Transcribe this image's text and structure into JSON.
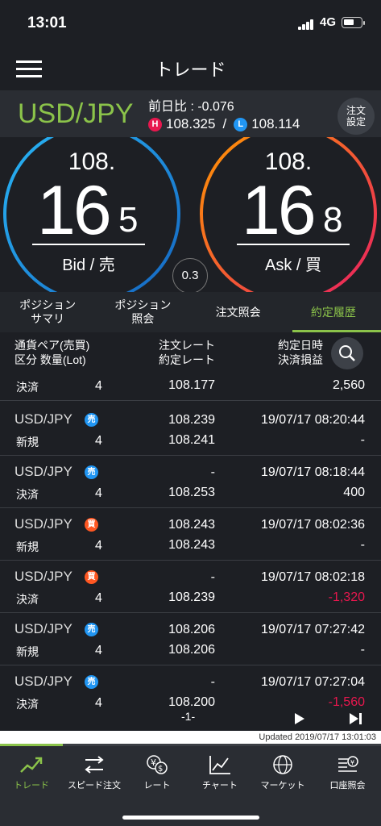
{
  "status": {
    "time": "13:01",
    "network": "4G"
  },
  "nav": {
    "title": "トレード"
  },
  "pair": {
    "name": "USD/JPY",
    "prev_label": "前日比 : -0.076",
    "high": "108.325",
    "low": "108.114",
    "separator": "/",
    "order_button": "注文\n設定"
  },
  "bid": {
    "prefix": "108.",
    "main": "16",
    "sub": "5",
    "label": "Bid / 売"
  },
  "ask": {
    "prefix": "108.",
    "main": "16",
    "sub": "8",
    "label": "Ask / 買"
  },
  "spread": "0.3",
  "tabs": [
    "ポジション\nサマリ",
    "ポジション\n照会",
    "注文照会",
    "約定履歴"
  ],
  "header": {
    "col1_line1": "通貨ペア(売買)",
    "col1_line2": "区分 数量(Lot)",
    "col2_line1": "注文レート",
    "col2_line2": "約定レート",
    "col3_line1": "約定日時",
    "col3_line2": "決済損益"
  },
  "rows": [
    {
      "pair": "",
      "side": "",
      "kind": "決済",
      "qty": "4",
      "rate1": "",
      "rate2": "108.177",
      "date": "",
      "pl": "2,560",
      "pl_color": "#ffffff"
    },
    {
      "pair": "USD/JPY",
      "side": "売",
      "kind": "新規",
      "qty": "4",
      "rate1": "108.239",
      "rate2": "108.241",
      "date": "19/07/17 08:20:44",
      "pl": "-",
      "pl_color": "#ffffff"
    },
    {
      "pair": "USD/JPY",
      "side": "売",
      "kind": "決済",
      "qty": "4",
      "rate1": "-",
      "rate2": "108.253",
      "date": "19/07/17 08:18:44",
      "pl": "400",
      "pl_color": "#ffffff"
    },
    {
      "pair": "USD/JPY",
      "side": "買",
      "kind": "新規",
      "qty": "4",
      "rate1": "108.243",
      "rate2": "108.243",
      "date": "19/07/17 08:02:36",
      "pl": "-",
      "pl_color": "#ffffff"
    },
    {
      "pair": "USD/JPY",
      "side": "買",
      "kind": "決済",
      "qty": "4",
      "rate1": "-",
      "rate2": "108.239",
      "date": "19/07/17 08:02:18",
      "pl": "-1,320",
      "pl_color": "#e8174e"
    },
    {
      "pair": "USD/JPY",
      "side": "売",
      "kind": "新規",
      "qty": "4",
      "rate1": "108.206",
      "rate2": "108.206",
      "date": "19/07/17 07:27:42",
      "pl": "-",
      "pl_color": "#ffffff"
    },
    {
      "pair": "USD/JPY",
      "side": "売",
      "kind": "決済",
      "qty": "4",
      "rate1": "-",
      "rate2": "108.200",
      "date": "19/07/17 07:27:04",
      "pl": "-1,560",
      "pl_color": "#e8174e"
    }
  ],
  "pager": {
    "page": "-1-"
  },
  "updated": "Updated  2019/07/17 13:01:03",
  "tabbar": [
    {
      "label": "トレード",
      "icon": "trade-icon"
    },
    {
      "label": "スピード注文",
      "icon": "speed-order-icon"
    },
    {
      "label": "レート",
      "icon": "rate-icon"
    },
    {
      "label": "チャート",
      "icon": "chart-icon"
    },
    {
      "label": "マーケット",
      "icon": "market-icon"
    },
    {
      "label": "口座照会",
      "icon": "account-icon"
    }
  ],
  "colors": {
    "accent": "#8bc34a",
    "sell": "#2196f3",
    "buy": "#ff5722",
    "loss": "#e8174e"
  }
}
